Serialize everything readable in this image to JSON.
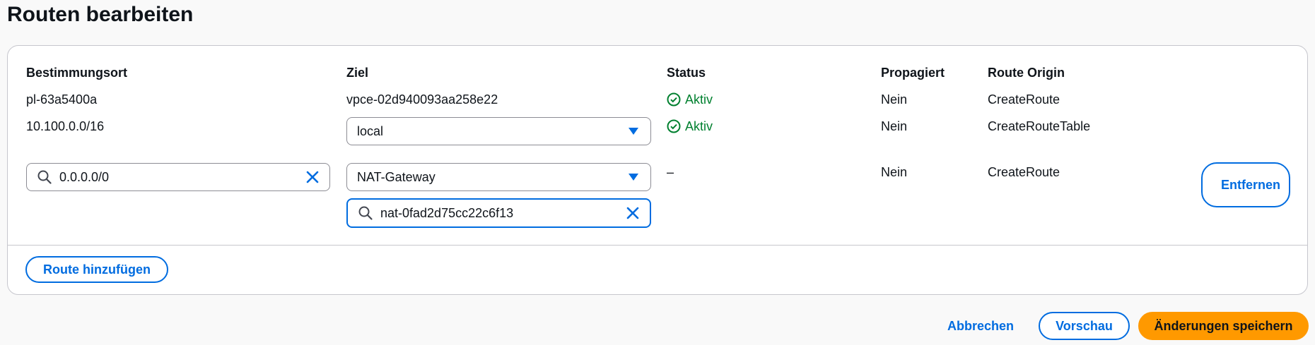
{
  "page": {
    "title": "Routen bearbeiten"
  },
  "table": {
    "headers": {
      "destination": "Bestimmungsort",
      "target": "Ziel",
      "status": "Status",
      "propagated": "Propagiert",
      "route_origin": "Route Origin"
    },
    "rows": [
      {
        "destination": "pl-63a5400a",
        "target": "vpce-02d940093aa258e22",
        "status": "Aktiv",
        "propagated": "Nein",
        "route_origin": "CreateRoute"
      },
      {
        "destination": "10.100.0.0/16",
        "target_select": "local",
        "status": "Aktiv",
        "propagated": "Nein",
        "route_origin": "CreateRouteTable"
      },
      {
        "destination_input": "0.0.0.0/0",
        "target_select": "NAT-Gateway",
        "target_search": "nat-0fad2d75cc22c6f13",
        "status": "–",
        "propagated": "Nein",
        "route_origin": "CreateRoute",
        "remove_label": "Entfernen"
      }
    ]
  },
  "actions": {
    "add_route": "Route hinzufügen",
    "cancel": "Abbrechen",
    "preview": "Vorschau",
    "save": "Änderungen speichern"
  },
  "colors": {
    "accent": "#006ce0",
    "success": "#00802f",
    "primary_button": "#ff9900"
  },
  "icons": [
    "check-circle-icon",
    "search-icon",
    "clear-icon",
    "caret-down-icon"
  ]
}
